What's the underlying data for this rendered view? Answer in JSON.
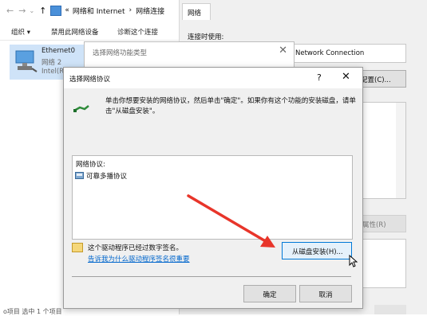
{
  "explorer": {
    "breadcrumb_prefix": "«",
    "breadcrumb_1": "网络和 Internet",
    "breadcrumb_sep": "›",
    "breadcrumb_2": "网络连接",
    "toolbar": {
      "organize": "组织 ▾",
      "disable": "禁用此网络设备",
      "diagnose": "诊断这个连接"
    },
    "adapter": {
      "name": "Ethernet0",
      "network": "网络 2",
      "driver": "Intel(R)"
    },
    "bottom_text": "ο项目   选中 1 个项目"
  },
  "properties": {
    "tab": "网络",
    "connect_using_label": "连接时使用:",
    "adapter_name": "Network Connection",
    "configure_button": "配置(C)...",
    "properties_button": "属性(R)"
  },
  "middle_dialog": {
    "title": "选择网络功能类型"
  },
  "dialog": {
    "title": "选择网络协议",
    "help": "?",
    "close": "✕",
    "instruction": "单击你想要安装的网络协议，然后单击\"确定\"。如果你有这个功能的安装磁盘，请单击\"从磁盘安装\"。",
    "protocol_header": "网络协议:",
    "protocols": [
      "可靠多播协议"
    ],
    "signed_text": "这个驱动程序已经过数字签名。",
    "why_link": "告诉我为什么驱动程序签名很重要",
    "have_disk_button": "从磁盘安装(H)...",
    "ok_button": "确定",
    "cancel_button": "取消"
  },
  "colors": {
    "accent": "#0078d7",
    "arrow": "#e8352a",
    "link": "#0066cc"
  }
}
